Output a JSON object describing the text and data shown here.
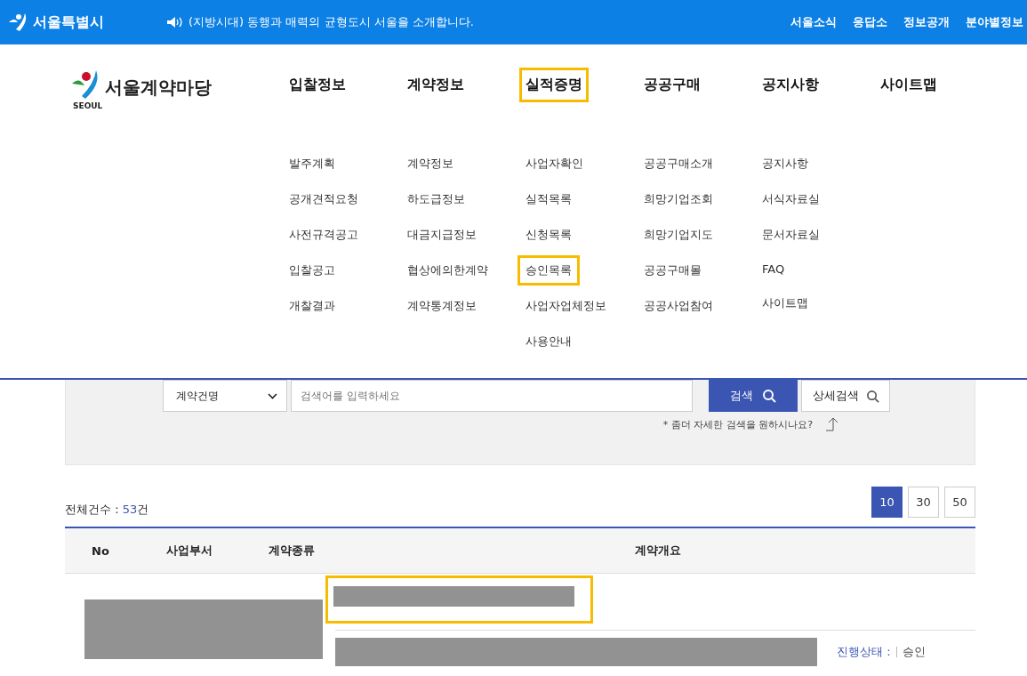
{
  "top_bar": {
    "brand": "서울특별시",
    "notice": "(지방시대) 동행과 매력의 균형도시 서울을 소개합니다.",
    "links": [
      "서울소식",
      "응답소",
      "정보공개",
      "분야별정보"
    ]
  },
  "header": {
    "logo_caption": "SEOUL",
    "logo_title": "서울계약마당"
  },
  "nav": [
    {
      "label": "입찰정보",
      "highlighted": false,
      "items": [
        {
          "label": "발주계획",
          "highlighted": false
        },
        {
          "label": "공개견적요청",
          "highlighted": false
        },
        {
          "label": "사전규격공고",
          "highlighted": false
        },
        {
          "label": "입찰공고",
          "highlighted": false
        },
        {
          "label": "개찰결과",
          "highlighted": false
        }
      ]
    },
    {
      "label": "계약정보",
      "highlighted": false,
      "items": [
        {
          "label": "계약정보",
          "highlighted": false
        },
        {
          "label": "하도급정보",
          "highlighted": false
        },
        {
          "label": "대금지급정보",
          "highlighted": false
        },
        {
          "label": "협상에의한계약",
          "highlighted": false
        },
        {
          "label": "계약통계정보",
          "highlighted": false
        }
      ]
    },
    {
      "label": "실적증명",
      "highlighted": true,
      "items": [
        {
          "label": "사업자확인",
          "highlighted": false
        },
        {
          "label": "실적목록",
          "highlighted": false
        },
        {
          "label": "신청목록",
          "highlighted": false
        },
        {
          "label": "승인목록",
          "highlighted": true
        },
        {
          "label": "사업자업체정보",
          "highlighted": false
        },
        {
          "label": "사용안내",
          "highlighted": false
        }
      ]
    },
    {
      "label": "공공구매",
      "highlighted": false,
      "items": [
        {
          "label": "공공구매소개",
          "highlighted": false
        },
        {
          "label": "희망기업조회",
          "highlighted": false
        },
        {
          "label": "희망기업지도",
          "highlighted": false
        },
        {
          "label": "공공구매몰",
          "highlighted": false
        },
        {
          "label": "공공사업참여",
          "highlighted": false
        }
      ]
    },
    {
      "label": "공지사항",
      "highlighted": false,
      "items": [
        {
          "label": "공지사항",
          "highlighted": false
        },
        {
          "label": "서식자료실",
          "highlighted": false
        },
        {
          "label": "문서자료실",
          "highlighted": false
        },
        {
          "label": "FAQ",
          "highlighted": false
        },
        {
          "label": "사이트맵",
          "highlighted": false
        }
      ]
    },
    {
      "label": "사이트맵",
      "highlighted": false
    }
  ],
  "search": {
    "category": "계약건명",
    "placeholder": "검색어를 입력하세요",
    "search_button": "검색",
    "detail_button": "상세검색",
    "hint": "* 좀더 자세한 검색을 원하시나요?"
  },
  "results": {
    "total_label": "전체건수 : ",
    "total_count": "53",
    "total_unit": "건",
    "page_sizes": [
      {
        "label": "10",
        "selected": true
      },
      {
        "label": "30",
        "selected": false
      },
      {
        "label": "50",
        "selected": false
      }
    ]
  },
  "table": {
    "columns": [
      "No",
      "사업부서",
      "계약종류",
      "계약개요"
    ],
    "rows": [
      {
        "title_highlighted": true,
        "status_label": "진행상태 :",
        "status": "승인"
      }
    ]
  }
}
